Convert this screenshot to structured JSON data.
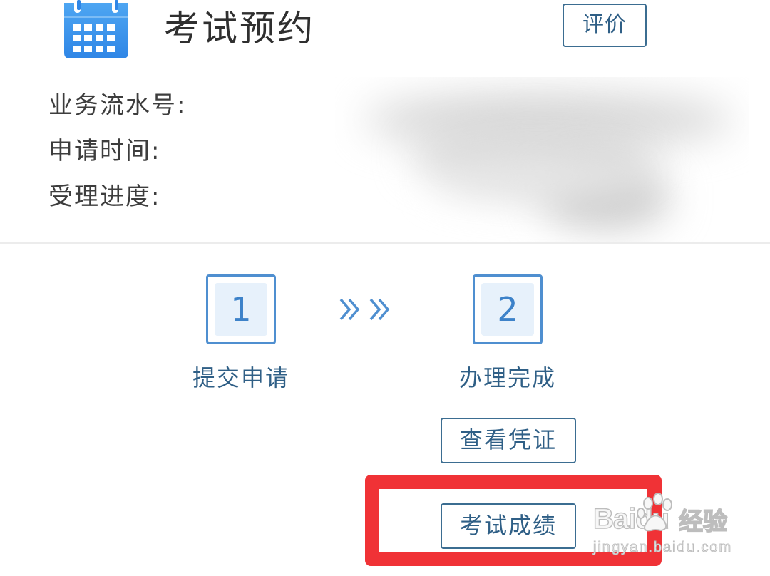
{
  "header": {
    "icon": "calendar-icon",
    "title": "考试预约",
    "rate_button": "评价"
  },
  "info": {
    "serial_label": "业务流水号:",
    "time_label": "申请时间:",
    "progress_label": "受理进度:"
  },
  "steps": [
    {
      "number": "1",
      "label": "提交申请"
    },
    {
      "number": "2",
      "label": "办理完成"
    }
  ],
  "actions": {
    "view_voucher": "查看凭证",
    "exam_score": "考试成绩"
  },
  "highlight_color": "#f03236",
  "accent_color": "#3d82c9",
  "watermark": {
    "logo": "Baidu",
    "brand": "经验",
    "url": "jingyan.baidu.com"
  }
}
